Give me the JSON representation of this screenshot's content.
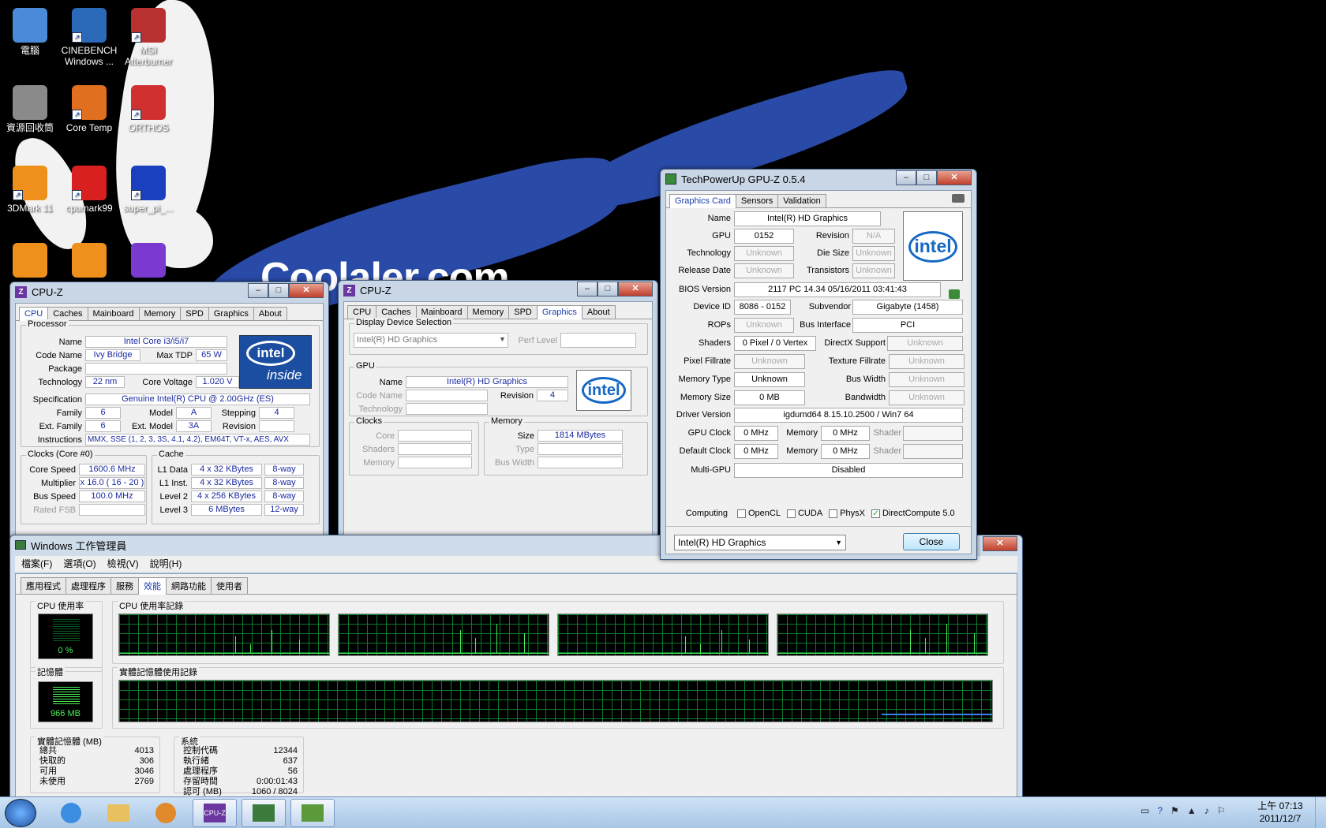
{
  "desktop": {
    "background_text": "Coolaler.com",
    "icons": [
      {
        "label": "電腦",
        "icon": "computer-icon"
      },
      {
        "label": "CINEBENCH Windows ...",
        "icon": "cinebench-icon"
      },
      {
        "label": "MSI Afterburner",
        "icon": "afterburner-icon"
      },
      {
        "label": "資源回收筒",
        "icon": "recycle-bin-icon"
      },
      {
        "label": "Core Temp",
        "icon": "core-temp-icon"
      },
      {
        "label": "ORTHOS",
        "icon": "orthos-icon"
      },
      {
        "label": "3DMark 11",
        "icon": "3dmark-icon"
      },
      {
        "label": "cpumark99",
        "icon": "cpumark-icon"
      },
      {
        "label": "super_pi_...",
        "icon": "superpi-icon"
      }
    ]
  },
  "cpuz1": {
    "title": "CPU-Z",
    "tabs": [
      "CPU",
      "Caches",
      "Mainboard",
      "Memory",
      "SPD",
      "Graphics",
      "About"
    ],
    "processor_label": "Processor",
    "name_label": "Name",
    "name": "Intel Core i3/i5/i7",
    "codename_label": "Code Name",
    "codename": "Ivy Bridge",
    "maxtdp_label": "Max TDP",
    "maxtdp": "65 W",
    "package_label": "Package",
    "technology_label": "Technology",
    "technology": "22 nm",
    "corevoltage_label": "Core Voltage",
    "corevoltage": "1.020 V",
    "spec_label": "Specification",
    "spec": "Genuine Intel(R) CPU  @ 2.00GHz (ES)",
    "family_label": "Family",
    "family": "6",
    "model_label": "Model",
    "model": "A",
    "stepping_label": "Stepping",
    "stepping": "4",
    "extfamily_label": "Ext. Family",
    "extfamily": "6",
    "extmodel_label": "Ext. Model",
    "extmodel": "3A",
    "revision_label": "Revision",
    "instructions_label": "Instructions",
    "instructions": "MMX, SSE (1, 2, 3, 3S, 4.1, 4.2), EM64T, VT-x, AES, AVX",
    "clocks_label": "Clocks (Core #0)",
    "corespeed_label": "Core Speed",
    "corespeed": "1600.6 MHz",
    "multiplier_label": "Multiplier",
    "multiplier": "x 16.0 ( 16 - 20 )",
    "busspeed_label": "Bus Speed",
    "busspeed": "100.0 MHz",
    "ratedfsb_label": "Rated FSB",
    "cache_label": "Cache",
    "l1data_label": "L1 Data",
    "l1data": "4 x 32 KBytes",
    "l1data_way": "8-way",
    "l1inst_label": "L1 Inst.",
    "l1inst": "4 x 32 KBytes",
    "l1inst_way": "8-way",
    "level2_label": "Level 2",
    "level2": "4 x 256 KBytes",
    "level2_way": "8-way",
    "level3_label": "Level 3",
    "level3": "6 MBytes",
    "level3_way": "12-way",
    "intel_badge_top": "intel",
    "intel_badge_bottom": "inside"
  },
  "cpuz2": {
    "title": "CPU-Z",
    "tabs": [
      "CPU",
      "Caches",
      "Mainboard",
      "Memory",
      "SPD",
      "Graphics",
      "About"
    ],
    "display_sel_label": "Display Device Selection",
    "display_device": "Intel(R) HD Graphics",
    "perf_level_label": "Perf Level",
    "gpu_label": "GPU",
    "name_label": "Name",
    "name": "Intel(R) HD Graphics",
    "codename_label": "Code Name",
    "revision_label": "Revision",
    "revision": "4",
    "technology_label": "Technology",
    "clocks_label": "Clocks",
    "core_label": "Core",
    "shaders_label": "Shaders",
    "memory_clock_label": "Memory",
    "memory_label": "Memory",
    "size_label": "Size",
    "size": "1814 MBytes",
    "type_label": "Type",
    "buswidth_label": "Bus Width",
    "intel_logo": "intel"
  },
  "gpuz": {
    "title": "TechPowerUp GPU-Z 0.5.4",
    "tabs": [
      "Graphics Card",
      "Sensors",
      "Validation"
    ],
    "name_label": "Name",
    "name": "Intel(R) HD Graphics",
    "gpu_label": "GPU",
    "gpu": "0152",
    "revision_label": "Revision",
    "revision": "N/A",
    "technology_label": "Technology",
    "technology": "Unknown",
    "diesize_label": "Die Size",
    "diesize": "Unknown",
    "releasedate_label": "Release Date",
    "releasedate": "Unknown",
    "transistors_label": "Transistors",
    "transistors": "Unknown",
    "bios_label": "BIOS Version",
    "bios": "2117 PC 14.34  05/16/2011  03:41:43",
    "deviceid_label": "Device ID",
    "deviceid": "8086 - 0152",
    "subvendor_label": "Subvendor",
    "subvendor": "Gigabyte (1458)",
    "rops_label": "ROPs",
    "rops": "Unknown",
    "businterface_label": "Bus Interface",
    "businterface": "PCI",
    "shaders_label": "Shaders",
    "shaders": "0 Pixel / 0 Vertex",
    "directx_label": "DirectX Support",
    "directx": "Unknown",
    "pixelfill_label": "Pixel Fillrate",
    "pixelfill": "Unknown",
    "texturefill_label": "Texture Fillrate",
    "texturefill": "Unknown",
    "memtype_label": "Memory Type",
    "memtype": "Unknown",
    "buswidth_label": "Bus Width",
    "buswidth": "Unknown",
    "memsize_label": "Memory Size",
    "memsize": "0 MB",
    "bandwidth_label": "Bandwidth",
    "bandwidth": "Unknown",
    "driver_label": "Driver Version",
    "driver": "igdumd64 8.15.10.2500 / Win7 64",
    "gpuclock_label": "GPU Clock",
    "gpuclock": "0 MHz",
    "memory_label": "Memory",
    "memclock": "0 MHz",
    "shader_label": "Shader",
    "defaultclock_label": "Default Clock",
    "defaultclock": "0 MHz",
    "defaultmem": "0 MHz",
    "multigpu_label": "Multi-GPU",
    "multigpu": "Disabled",
    "computing_label": "Computing",
    "opencl": "OpenCL",
    "cuda": "CUDA",
    "physx": "PhysX",
    "directcompute": "DirectCompute 5.0",
    "device_select": "Intel(R) HD Graphics",
    "close": "Close",
    "intel_logo": "intel"
  },
  "taskmgr": {
    "title": "Windows 工作管理員",
    "menu": [
      "檔案(F)",
      "選項(O)",
      "檢視(V)",
      "說明(H)"
    ],
    "tabs": [
      "應用程式",
      "處理程序",
      "服務",
      "效能",
      "網路功能",
      "使用者"
    ],
    "cpu_usage_label": "CPU 使用率",
    "cpu_usage": "0 %",
    "cpu_history_label": "CPU 使用率記錄",
    "memory_label": "記憶體",
    "memory_value": "966 MB",
    "memory_history_label": "實體記憶體使用記錄",
    "physical_label": "實體記憶體 (MB)",
    "physical": [
      {
        "k": "總共",
        "v": "4013"
      },
      {
        "k": "快取的",
        "v": "306"
      },
      {
        "k": "可用",
        "v": "3046"
      },
      {
        "k": "未使用",
        "v": "2769"
      }
    ],
    "system_label": "系統",
    "system": [
      {
        "k": "控制代碼",
        "v": "12344"
      },
      {
        "k": "執行緒",
        "v": "637"
      },
      {
        "k": "處理程序",
        "v": "56"
      },
      {
        "k": "存留時間",
        "v": "0:00:01:43"
      },
      {
        "k": "認可 (MB)",
        "v": "1060 / 8024"
      }
    ]
  },
  "taskbar": {
    "clock_time": "上午 07:13",
    "clock_date": "2011/12/7"
  }
}
